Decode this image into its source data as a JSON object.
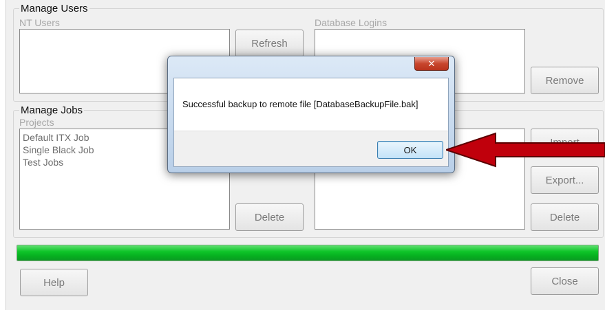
{
  "manage_users": {
    "title": "Manage Users",
    "nt_users_label": "NT Users",
    "db_logins_label": "Database Logins",
    "refresh_label": "Refresh",
    "remove_label": "Remove"
  },
  "manage_jobs": {
    "title": "Manage Jobs",
    "projects_label": "Projects",
    "projects": [
      "Default ITX Job",
      "Single Black Job",
      "Test Jobs"
    ],
    "import_label": "Import",
    "export_label": "Export...",
    "delete_left_label": "Delete",
    "delete_right_label": "Delete"
  },
  "progress": {
    "value": 1.0,
    "color": "#0fc52a"
  },
  "footer": {
    "help_label": "Help",
    "close_label": "Close"
  },
  "dialog": {
    "close_glyph": "✕",
    "message": "Successful backup to remote file [DatabaseBackupFile.bak]",
    "ok_label": "OK"
  },
  "annotation": {
    "arrow_color": "#c0000c"
  }
}
